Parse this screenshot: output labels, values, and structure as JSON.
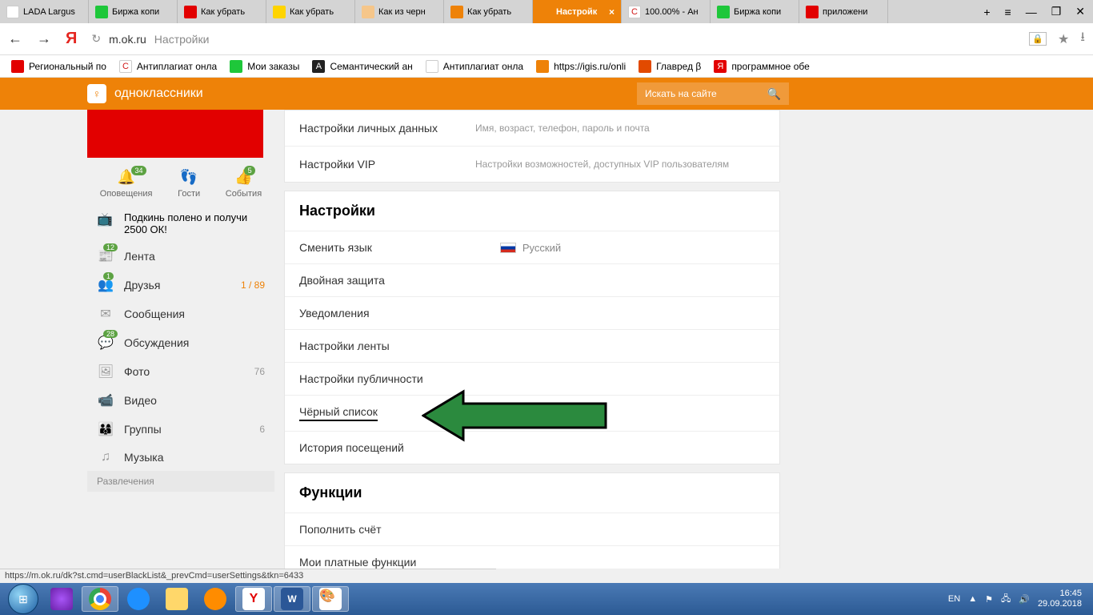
{
  "tabs": [
    {
      "label": "LADA Largus",
      "color": "#fff"
    },
    {
      "label": "Биржа копи",
      "color": "#1ec73a"
    },
    {
      "label": "Как убрать",
      "color": "#e20000"
    },
    {
      "label": "Как убрать",
      "color": "#ffd400"
    },
    {
      "label": "Как из черн",
      "color": "#f5c68a"
    },
    {
      "label": "Как убрать",
      "color": "#ee8208"
    },
    {
      "label": "Настройк",
      "color": "#ee8208",
      "active": true
    },
    {
      "label": "100.00% - Ан",
      "color": "#fff"
    },
    {
      "label": "Биржа копи",
      "color": "#1ec73a"
    },
    {
      "label": "приложени",
      "color": "#e20000"
    }
  ],
  "url": {
    "domain": "m.ok.ru",
    "path": "Настройки"
  },
  "bookmarks": [
    {
      "label": "Региональный по",
      "color": "#e20000"
    },
    {
      "label": "Антиплагиат онла",
      "color": "#d01717"
    },
    {
      "label": "Мои заказы",
      "color": "#1ec73a"
    },
    {
      "label": "Семантический ан",
      "color": "#222"
    },
    {
      "label": "Антиплагиат онла",
      "color": "#777"
    },
    {
      "label": "https://igis.ru/onli",
      "color": "#ee8208"
    },
    {
      "label": "Главред β",
      "color": "#e24a00"
    },
    {
      "label": "программное обе",
      "color": "#e20000"
    }
  ],
  "ok": {
    "brand": "одноклассники",
    "search_placeholder": "Искать на сайте",
    "stats": [
      {
        "label": "Оповещения",
        "badge": "34"
      },
      {
        "label": "Гости"
      },
      {
        "label": "События",
        "badge": "5"
      }
    ],
    "promo": "Подкинь полено и получи 2500 ОК!",
    "sidebar": [
      {
        "label": "Лента",
        "badge": "12"
      },
      {
        "label": "Друзья",
        "badge": "1",
        "count": "1 / 89",
        "orange": true
      },
      {
        "label": "Сообщения"
      },
      {
        "label": "Обсуждения",
        "badge": "28"
      },
      {
        "label": "Фото",
        "count": "76"
      },
      {
        "label": "Видео"
      },
      {
        "label": "Группы",
        "count": "6"
      },
      {
        "label": "Музыка"
      }
    ],
    "side_section": "Развлечения",
    "top_rows": [
      {
        "label": "Настройки личных данных",
        "desc": "Имя, возраст, телефон, пароль и почта"
      },
      {
        "label": "Настройки VIP",
        "desc": "Настройки возможностей, доступных VIP пользователям"
      }
    ],
    "settings_title": "Настройки",
    "settings": [
      {
        "label": "Сменить язык",
        "lang": "Русский"
      },
      {
        "label": "Двойная защита"
      },
      {
        "label": "Уведомления"
      },
      {
        "label": "Настройки ленты"
      },
      {
        "label": "Настройки публичности"
      },
      {
        "label": "Чёрный список",
        "highlight": true
      },
      {
        "label": "История посещений"
      }
    ],
    "functions_title": "Функции",
    "functions": [
      {
        "label": "Пополнить счёт"
      },
      {
        "label": "Мои платные функции"
      }
    ]
  },
  "status_url": "https://m.ok.ru/dk?st.cmd=userBlackList&_prevCmd=userSettings&tkn=6433",
  "tray": {
    "lang": "EN",
    "time": "16:45",
    "date": "29.09.2018"
  }
}
